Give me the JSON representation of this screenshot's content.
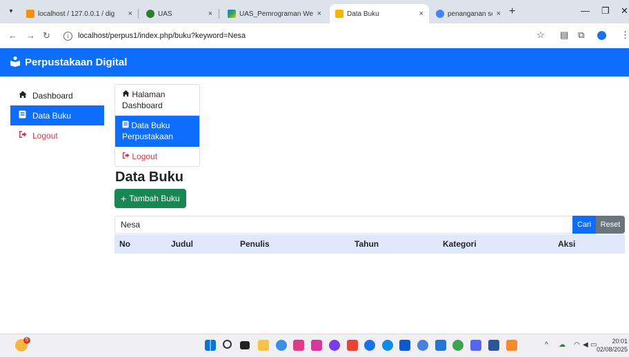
{
  "browser": {
    "tabs": [
      {
        "label": "localhost / 127.0.0.1 / dig",
        "favicon": "phpmyadmin-icon",
        "color": "#f29111"
      },
      {
        "label": "UAS",
        "favicon": "uas-icon",
        "color": "#2e7d32"
      },
      {
        "label": "UAS_Pemrograman Web",
        "favicon": "drive-icon",
        "color": "#1a73e8"
      },
      {
        "label": "Data Buku",
        "favicon": "page-icon",
        "color": "#f4b400"
      },
      {
        "label": "penanganan session ada",
        "favicon": "google-icon",
        "color": "#4285f4"
      }
    ],
    "close_glyph": "×",
    "new_tab_glyph": "+",
    "url": "localhost/perpus1/index.php/buku?keyword=Nesa"
  },
  "app": {
    "brand": "Perpustakaan Digital",
    "brand_color": "#0d6efd"
  },
  "sidebar": {
    "items": [
      {
        "label": "Dashboard",
        "icon": "home-icon"
      },
      {
        "label": "Data Buku",
        "icon": "book-icon",
        "active": true
      },
      {
        "label": "Logout",
        "icon": "logout-icon"
      }
    ]
  },
  "menu": {
    "items": [
      {
        "label": "Halaman Dashboard",
        "icon": "home-icon"
      },
      {
        "label": "Data Buku Perpustakaan",
        "icon": "book-icon",
        "active": true
      },
      {
        "label": "Logout",
        "icon": "logout-icon"
      }
    ]
  },
  "main": {
    "title": "Data Buku",
    "add_button": "Tambah Buku",
    "search": {
      "value": "Nesa",
      "search_button": "Cari",
      "reset_button": "Reset"
    },
    "table": {
      "columns": [
        "No",
        "Judul",
        "Penulis",
        "Tahun",
        "Kategori",
        "Aksi"
      ]
    }
  },
  "taskbar": {
    "weather_badge": "5",
    "time": "20:01",
    "date": "02/08/2025"
  },
  "colors": {
    "primary": "#0d6efd",
    "success": "#198754",
    "secondary": "#6c757d",
    "danger": "#dc3545",
    "table_head": "#dfe9fb"
  }
}
